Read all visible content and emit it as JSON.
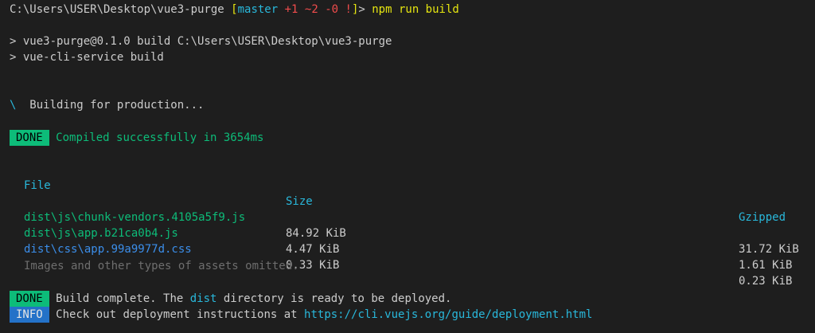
{
  "prompt": {
    "path": "C:\\Users\\USER\\Desktop\\vue3-purge",
    "branch_open": "[",
    "branch": "master",
    "added": "+1",
    "modified": "~2",
    "deleted": "-0",
    "bang": "!",
    "branch_close": "]",
    "arrow": ">",
    "command": "npm run build"
  },
  "script_lines": [
    "> vue3-purge@0.1.0 build C:\\Users\\USER\\Desktop\\vue3-purge",
    "> vue-cli-service build"
  ],
  "spinner": {
    "glyph": "\\",
    "text": "Building for production..."
  },
  "compile": {
    "badge": "DONE",
    "message": "Compiled successfully in 3654ms"
  },
  "table": {
    "headers": [
      "File",
      "Size",
      "Gzipped"
    ],
    "rows": [
      {
        "file": "dist\\js\\chunk-vendors.4105a5f9.js",
        "size": "84.92 KiB",
        "gzipped": "31.72 KiB",
        "color": "#0dbc79"
      },
      {
        "file": "dist\\js\\app.b21ca0b4.js",
        "size": "4.47 KiB",
        "gzipped": "1.61 KiB",
        "color": "#0dbc79"
      },
      {
        "file": "dist\\css\\app.99a9977d.css",
        "size": "0.33 KiB",
        "gzipped": "0.23 KiB",
        "color": "#3b8eea"
      }
    ],
    "note": "Images and other types of assets omitted."
  },
  "build_complete": {
    "badge": "DONE",
    "prefix": "Build complete. The ",
    "dir": "dist",
    "suffix": " directory is ready to be deployed."
  },
  "info": {
    "badge": "INFO",
    "prefix": "Check out deployment instructions at ",
    "url": "https://cli.vuejs.org/guide/deployment.html"
  },
  "colors": {
    "background": "#1e1e1e",
    "text": "#cccccc",
    "done_badge": "#0dbc79",
    "info_badge": "#2472c8",
    "header_cyan": "#29b8db"
  }
}
